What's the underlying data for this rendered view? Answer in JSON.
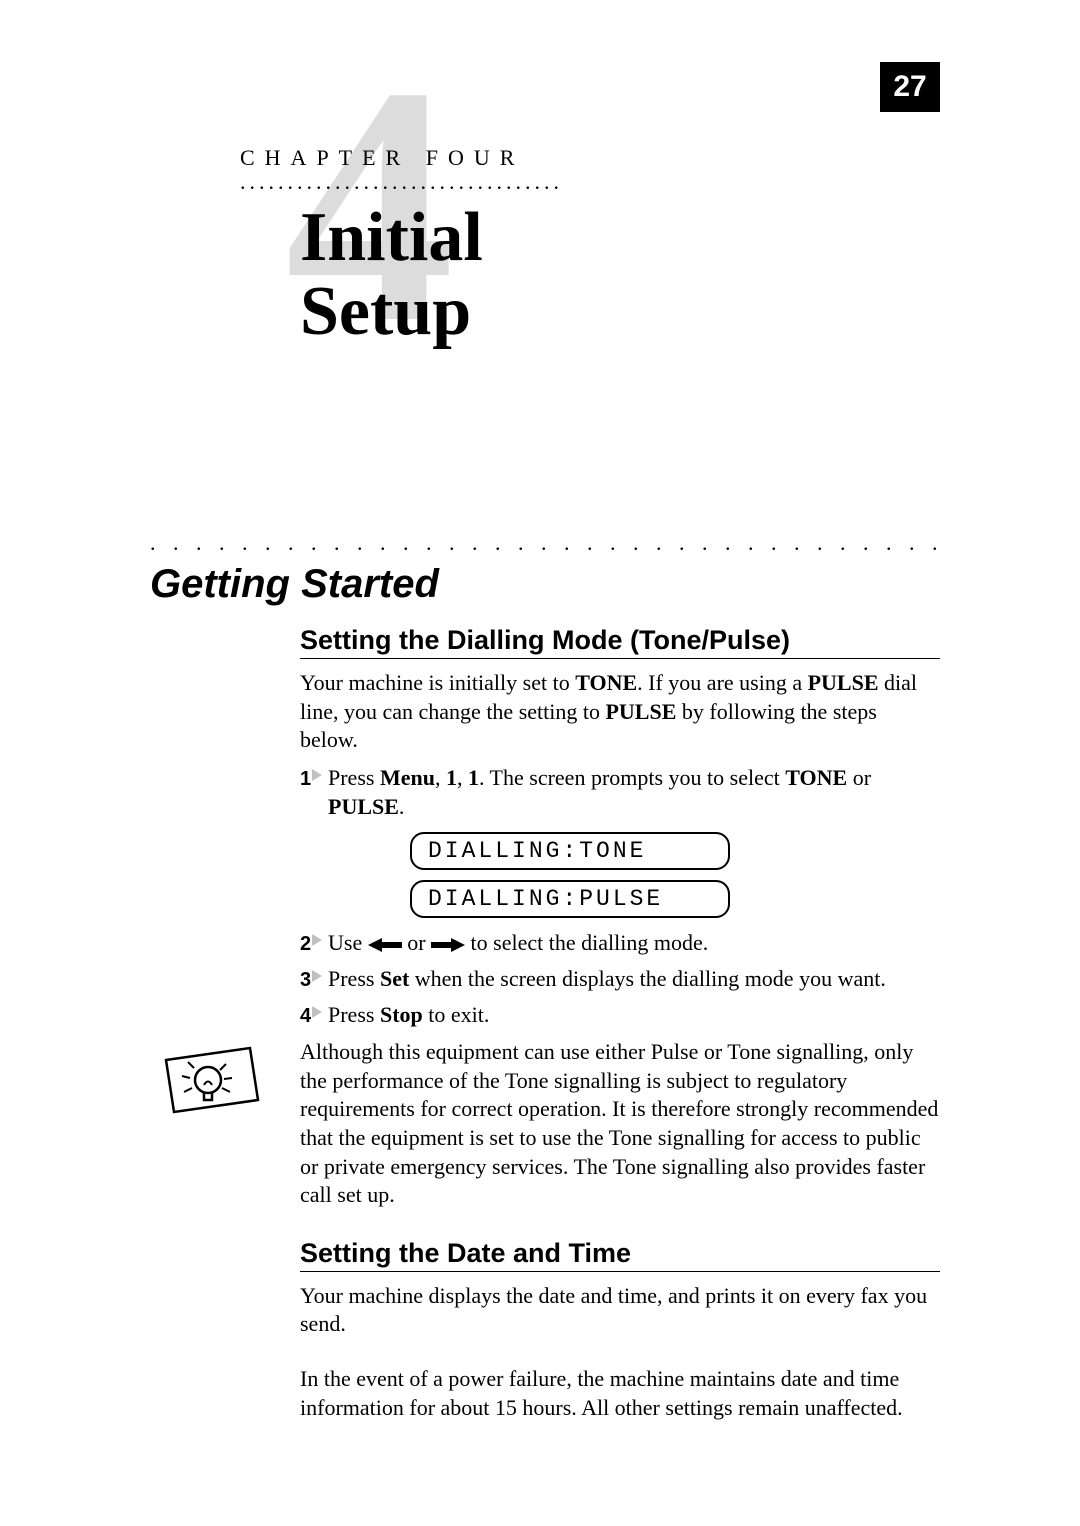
{
  "page_number": "27",
  "chapter": {
    "watermark": "4",
    "label": "CHAPTER FOUR",
    "title_line1": "Initial",
    "title_line2": "Setup"
  },
  "section": {
    "title": "Getting Started"
  },
  "sub1": {
    "heading": "Setting the Dialling Mode (Tone/Pulse)",
    "intro_pre": "Your machine is initially set to ",
    "intro_b1": "TONE",
    "intro_mid": ". If you are using a ",
    "intro_b2": "PULSE",
    "intro_post": " dial line, you can change the setting to ",
    "intro_b3": "PULSE",
    "intro_end": " by following the steps below.",
    "step1": {
      "num": "1",
      "pre": "Press ",
      "b1": "Menu",
      "c1": ", ",
      "b2": "1",
      "c2": ", ",
      "b3": "1",
      "mid": ". The screen prompts you to select ",
      "b4": "TONE",
      "or": " or ",
      "b5": "PULSE",
      "end": "."
    },
    "lcd1": "DIALLING:TONE",
    "lcd2": "DIALLING:PULSE",
    "step2": {
      "num": "2",
      "pre": "Use ",
      "or": " or ",
      "post": " to select the dialling mode."
    },
    "step3": {
      "num": "3",
      "pre": "Press ",
      "b1": "Set",
      "post": " when the screen displays the dialling mode you want."
    },
    "step4": {
      "num": "4",
      "pre": "Press ",
      "b1": "Stop",
      "post": " to exit."
    },
    "note": "Although this equipment can use either Pulse or Tone signalling, only the performance of the Tone signalling is subject to regulatory requirements for correct operation. It is therefore strongly recommended that the equipment is set to use the Tone signalling for access to public or private emergency services. The Tone signalling also provides faster call set up."
  },
  "sub2": {
    "heading": "Setting the Date and Time",
    "para1": "Your machine displays the date and time, and prints it on every fax you send.",
    "para2": "In the event of a power failure, the machine maintains date and time information for about 15 hours. All other settings remain unaffected."
  }
}
